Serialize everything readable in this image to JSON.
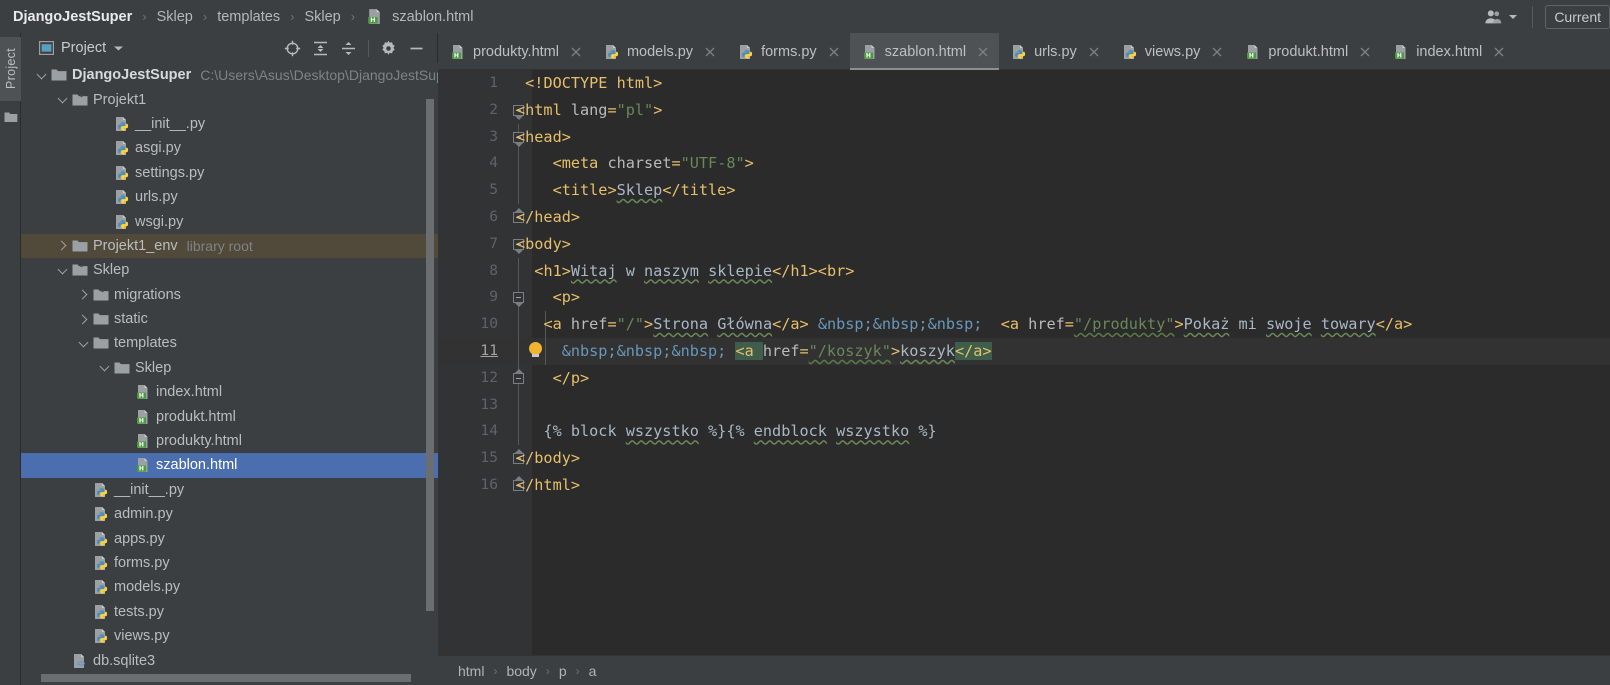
{
  "topbar": {
    "breadcrumbs": [
      {
        "label": "DjangoJestSuper",
        "bold": true,
        "icon": null
      },
      {
        "label": "Sklep",
        "bold": false,
        "icon": null
      },
      {
        "label": "templates",
        "bold": false,
        "icon": null
      },
      {
        "label": "Sklep",
        "bold": false,
        "icon": null
      },
      {
        "label": "szablon.html",
        "bold": false,
        "icon": "html-file-icon"
      }
    ],
    "separator": "›",
    "user_icon": "user-account-icon",
    "dropdown_icon": "chevron-down-icon",
    "current_config": "Current"
  },
  "toolstrip": {
    "project_label": "Project",
    "folder_icon": "folder-icon"
  },
  "project_panel": {
    "title": "Project",
    "title_icon": "project-window-icon",
    "dropdown_icon": "chevron-down-icon",
    "actions": [
      {
        "name": "locate-icon",
        "title": "Select Opened File"
      },
      {
        "name": "expand-all-icon",
        "title": "Expand All"
      },
      {
        "name": "collapse-all-icon",
        "title": "Collapse All"
      },
      {
        "name": "gear-icon",
        "title": "Settings"
      },
      {
        "name": "hide-icon",
        "title": "Hide"
      }
    ],
    "tree": [
      {
        "depth": 0,
        "label": "DjangoJestSuper",
        "sub": "C:\\Users\\Asus\\Desktop\\DjangoJestSup",
        "icon": "folder-icon",
        "toggle": "down",
        "bold": true,
        "state": "normal"
      },
      {
        "depth": 1,
        "label": "Projekt1",
        "sub": "",
        "icon": "module-folder-icon",
        "toggle": "down",
        "bold": false,
        "state": "normal"
      },
      {
        "depth": 3,
        "label": "__init__.py",
        "sub": "",
        "icon": "python-file-icon",
        "toggle": "",
        "bold": false,
        "state": "normal"
      },
      {
        "depth": 3,
        "label": "asgi.py",
        "sub": "",
        "icon": "python-file-icon",
        "toggle": "",
        "bold": false,
        "state": "normal"
      },
      {
        "depth": 3,
        "label": "settings.py",
        "sub": "",
        "icon": "python-file-icon",
        "toggle": "",
        "bold": false,
        "state": "normal"
      },
      {
        "depth": 3,
        "label": "urls.py",
        "sub": "",
        "icon": "python-file-icon",
        "toggle": "",
        "bold": false,
        "state": "normal"
      },
      {
        "depth": 3,
        "label": "wsgi.py",
        "sub": "",
        "icon": "python-file-icon",
        "toggle": "",
        "bold": false,
        "state": "normal"
      },
      {
        "depth": 1,
        "label": "Projekt1_env",
        "sub": "library root",
        "icon": "folder-icon",
        "toggle": "right",
        "bold": false,
        "state": "libroot"
      },
      {
        "depth": 1,
        "label": "Sklep",
        "sub": "",
        "icon": "module-folder-icon",
        "toggle": "down",
        "bold": false,
        "state": "normal"
      },
      {
        "depth": 2,
        "label": "migrations",
        "sub": "",
        "icon": "module-folder-icon",
        "toggle": "right",
        "bold": false,
        "state": "normal"
      },
      {
        "depth": 2,
        "label": "static",
        "sub": "",
        "icon": "folder-icon",
        "toggle": "right",
        "bold": false,
        "state": "normal"
      },
      {
        "depth": 2,
        "label": "templates",
        "sub": "",
        "icon": "folder-icon",
        "toggle": "down",
        "bold": false,
        "state": "normal"
      },
      {
        "depth": 3,
        "label": "Sklep",
        "sub": "",
        "icon": "folder-icon",
        "toggle": "down",
        "bold": false,
        "state": "normal"
      },
      {
        "depth": 4,
        "label": "index.html",
        "sub": "",
        "icon": "html-file-icon",
        "toggle": "",
        "bold": false,
        "state": "normal"
      },
      {
        "depth": 4,
        "label": "produkt.html",
        "sub": "",
        "icon": "html-file-icon",
        "toggle": "",
        "bold": false,
        "state": "normal"
      },
      {
        "depth": 4,
        "label": "produkty.html",
        "sub": "",
        "icon": "html-file-icon",
        "toggle": "",
        "bold": false,
        "state": "normal"
      },
      {
        "depth": 4,
        "label": "szablon.html",
        "sub": "",
        "icon": "html-file-icon",
        "toggle": "",
        "bold": false,
        "state": "selected"
      },
      {
        "depth": 2,
        "label": "__init__.py",
        "sub": "",
        "icon": "python-file-icon",
        "toggle": "",
        "bold": false,
        "state": "normal"
      },
      {
        "depth": 2,
        "label": "admin.py",
        "sub": "",
        "icon": "python-file-icon",
        "toggle": "",
        "bold": false,
        "state": "normal"
      },
      {
        "depth": 2,
        "label": "apps.py",
        "sub": "",
        "icon": "python-file-icon",
        "toggle": "",
        "bold": false,
        "state": "normal"
      },
      {
        "depth": 2,
        "label": "forms.py",
        "sub": "",
        "icon": "python-file-icon",
        "toggle": "",
        "bold": false,
        "state": "normal"
      },
      {
        "depth": 2,
        "label": "models.py",
        "sub": "",
        "icon": "python-file-icon",
        "toggle": "",
        "bold": false,
        "state": "normal"
      },
      {
        "depth": 2,
        "label": "tests.py",
        "sub": "",
        "icon": "python-file-icon",
        "toggle": "",
        "bold": false,
        "state": "normal"
      },
      {
        "depth": 2,
        "label": "views.py",
        "sub": "",
        "icon": "python-file-icon",
        "toggle": "",
        "bold": false,
        "state": "normal"
      },
      {
        "depth": 1,
        "label": "db.sqlite3",
        "sub": "",
        "icon": "sqlite-file-icon",
        "toggle": "",
        "bold": false,
        "state": "normal"
      }
    ]
  },
  "editor": {
    "tabs": [
      {
        "label": "produkty.html",
        "icon": "html-file-icon",
        "active": false,
        "close_icon": "close-icon"
      },
      {
        "label": "models.py",
        "icon": "python-file-icon",
        "active": false,
        "close_icon": "close-icon"
      },
      {
        "label": "forms.py",
        "icon": "python-file-icon",
        "active": false,
        "close_icon": "close-icon"
      },
      {
        "label": "szablon.html",
        "icon": "html-file-icon",
        "active": true,
        "close_icon": "close-icon"
      },
      {
        "label": "urls.py",
        "icon": "python-file-icon",
        "active": false,
        "close_icon": "close-icon"
      },
      {
        "label": "views.py",
        "icon": "python-file-icon",
        "active": false,
        "close_icon": "close-icon"
      },
      {
        "label": "produkt.html",
        "icon": "html-file-icon",
        "active": false,
        "close_icon": "close-icon"
      },
      {
        "label": "index.html",
        "icon": "html-file-icon",
        "active": false,
        "close_icon": "close-icon"
      }
    ],
    "line_numbers": [
      "1",
      "2",
      "3",
      "4",
      "5",
      "6",
      "7",
      "8",
      "9",
      "10",
      "11",
      "12",
      "13",
      "14",
      "15",
      "16"
    ],
    "current_line": 11,
    "code_lines": [
      " <!DOCTYPE html>",
      "<html lang=\"pl\">",
      "<head>",
      "    <meta charset=\"UTF-8\">",
      "    <title>Sklep</title>",
      "</head>",
      "<body>",
      "  <h1>Witaj w naszym sklepie</h1><br>",
      "    <p>",
      "    <a href=\"/\">Strona Główna</a> &nbsp;&nbsp;&nbsp;  <a href=\"/produkty\">Pokaż mi swoje towary</a>",
      "      &nbsp;&nbsp;&nbsp; <a href=\"/koszyk\">koszyk</a>",
      "    </p>",
      "",
      "   {% block wszystko %}{% endblock wszystko %}",
      "</body>",
      "</html>"
    ],
    "bottom_breadcrumb": [
      "html",
      "body",
      "p",
      "a"
    ],
    "bottom_breadcrumb_sep": "›"
  },
  "colors": {
    "accent_selection": "#4b6eaf",
    "library_root": "#51493a",
    "editor_bg": "#2b2b2b",
    "panel_bg": "#3c3f41",
    "gutter_bg": "#313335",
    "tag": "#e8bf6a",
    "string": "#6a8759",
    "text": "#a9b7c6",
    "entity": "#6897bb",
    "bulb": "#f0b432"
  }
}
